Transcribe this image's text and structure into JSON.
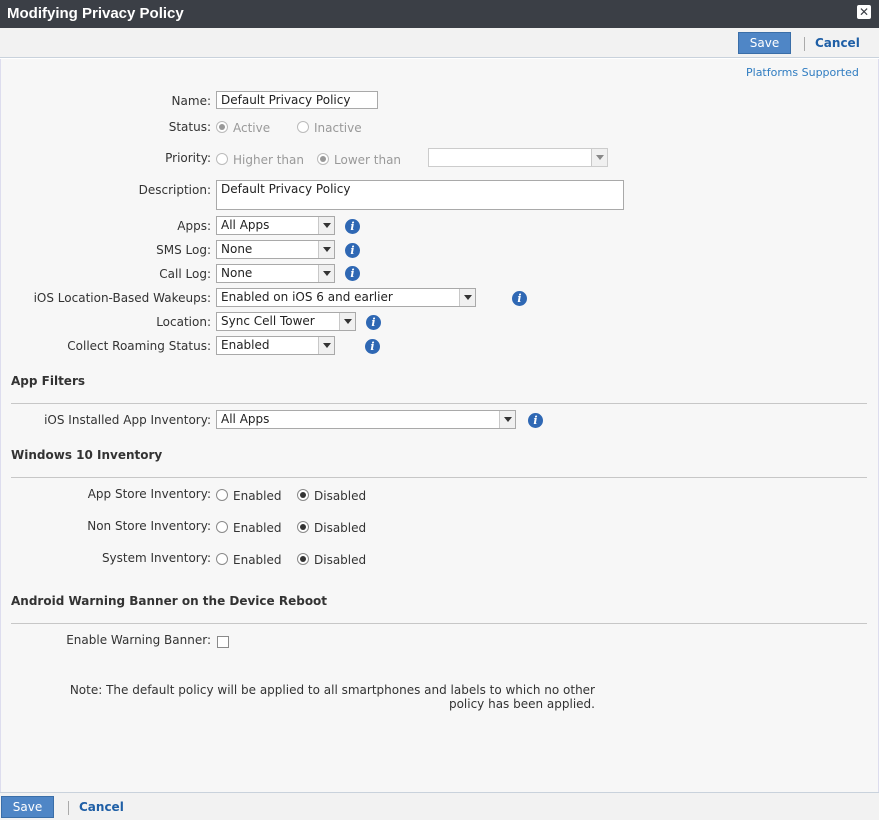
{
  "window": {
    "title": "Modifying Privacy Policy",
    "close_icon": "close-icon"
  },
  "toolbar": {
    "save_label": "Save",
    "cancel_label": "Cancel"
  },
  "platforms_link": "Platforms Supported",
  "form": {
    "name": {
      "label": "Name:",
      "value": "Default Privacy Policy"
    },
    "status": {
      "label": "Status:",
      "option_active": "Active",
      "option_inactive": "Inactive",
      "selected": "Active"
    },
    "priority": {
      "label": "Priority:",
      "option_higher": "Higher than",
      "option_lower": "Lower than",
      "selected": "Lower than",
      "policy_value": ""
    },
    "description": {
      "label": "Description:",
      "value": "Default Privacy Policy"
    },
    "apps": {
      "label": "Apps:",
      "value": "All Apps"
    },
    "sms_log": {
      "label": "SMS Log:",
      "value": "None"
    },
    "call_log": {
      "label": "Call Log:",
      "value": "None"
    },
    "ios_wakeups": {
      "label": "iOS Location-Based Wakeups:",
      "value": "Enabled on iOS 6 and earlier"
    },
    "location": {
      "label": "Location:",
      "value": "Sync Cell Tower"
    },
    "roaming": {
      "label": "Collect Roaming Status:",
      "value": "Enabled"
    }
  },
  "app_filters": {
    "heading": "App Filters",
    "ios_inventory": {
      "label": "iOS Installed App Inventory:",
      "value": "All Apps"
    }
  },
  "windows10": {
    "heading": "Windows 10 Inventory",
    "enabled_label": "Enabled",
    "disabled_label": "Disabled",
    "rows": [
      {
        "label": "App Store Inventory:",
        "selected": "Disabled"
      },
      {
        "label": "Non Store Inventory:",
        "selected": "Disabled"
      },
      {
        "label": "System Inventory:",
        "selected": "Disabled"
      }
    ]
  },
  "android_banner": {
    "heading": "Android Warning Banner on the Device Reboot",
    "enable_label": "Enable Warning Banner:",
    "checked": false
  },
  "note": "Note: The default policy will be applied to all smartphones and labels to which no other policy has been applied.",
  "colors": {
    "accent": "#4f86c6",
    "titlebar": "#3b3f46",
    "link": "#1f5fa6",
    "info": "#2f68b4"
  }
}
